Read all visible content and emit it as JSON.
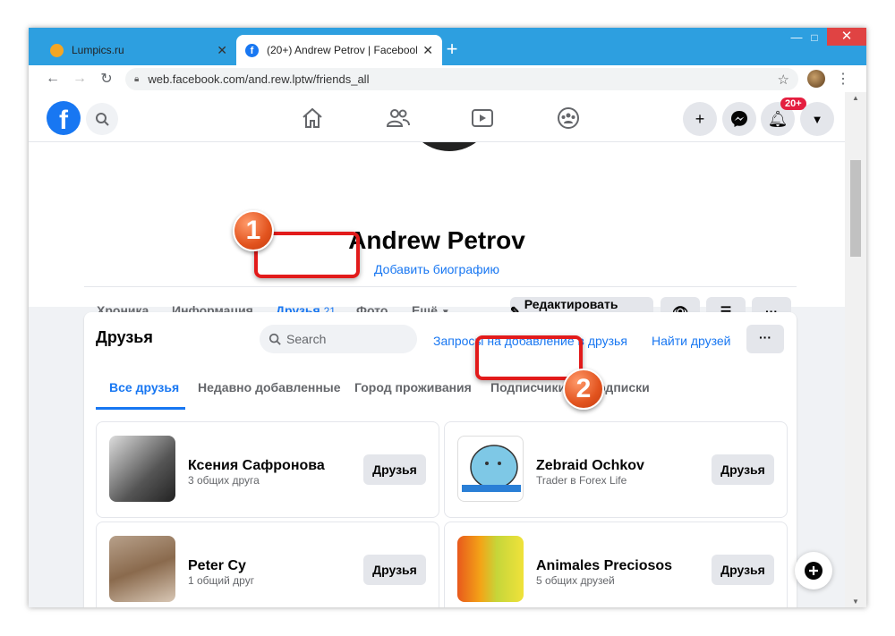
{
  "browser": {
    "tabs": [
      {
        "title": "Lumpics.ru"
      },
      {
        "title": "(20+) Andrew Petrov | Facebook"
      }
    ],
    "new_tab": "+",
    "url": "web.facebook.com/and.rew.lptw/friends_all",
    "window_controls": {
      "minimize": "—",
      "maximize": "□",
      "close": "✕"
    }
  },
  "fb_header": {
    "logo": "f",
    "notification_count": "20+",
    "icons": [
      "search-icon",
      "home-icon",
      "friends-icon",
      "watch-icon",
      "groups-icon",
      "plus-icon",
      "messenger-icon",
      "bell-icon",
      "caret-down-icon"
    ]
  },
  "profile": {
    "name": "Andrew Petrov",
    "bio_link": "Добавить биографию",
    "tabs": [
      {
        "label": "Хроника"
      },
      {
        "label": "Информация"
      },
      {
        "label": "Друзья",
        "count": "21",
        "active": true
      },
      {
        "label": "Фото"
      },
      {
        "label": "Ещё"
      }
    ],
    "edit_button": "Редактировать про...",
    "more_button": "···"
  },
  "friends": {
    "title": "Друзья",
    "search_placeholder": "Search",
    "requests_link": "Запросы на добавление в друзья",
    "find_link": "Найти друзей",
    "more": "···",
    "tabs": [
      {
        "label": "Все друзья",
        "active": true
      },
      {
        "label": "Недавно добавленные"
      },
      {
        "label": "Город проживания"
      },
      {
        "label": "Подписчики"
      },
      {
        "label": "Подписки"
      }
    ],
    "items": [
      {
        "name": "Ксения Сафронова",
        "sub": "3 общих друга",
        "button": "Друзья"
      },
      {
        "name": "Zebraid Ochkov",
        "sub": "Trader в Forex Life",
        "button": "Друзья"
      },
      {
        "name": "Peter Cy",
        "sub": "1 общий друг",
        "button": "Друзья"
      },
      {
        "name": "Animales Preciosos",
        "sub": "5 общих друзей",
        "button": "Друзья"
      }
    ]
  },
  "annotations": {
    "badge1": "1",
    "badge2": "2",
    "color": "#e21b1b"
  },
  "colors": {
    "accent": "#1877f2",
    "chrome": "#2d9fe0"
  }
}
